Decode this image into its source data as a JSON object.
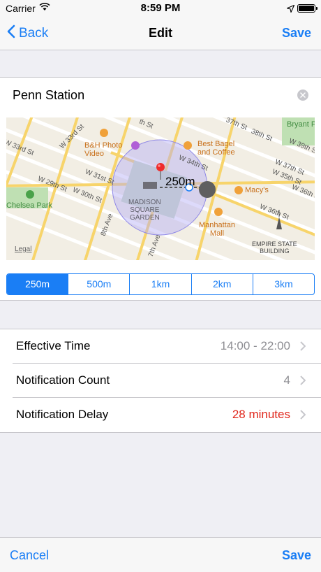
{
  "status": {
    "carrier": "Carrier",
    "time": "8:59 PM"
  },
  "nav": {
    "back_label": "Back",
    "title": "Edit",
    "save_label": "Save"
  },
  "location": {
    "name": "Penn Station"
  },
  "map": {
    "radius_label": "250m",
    "legal": "Legal",
    "streets": [
      "W 33rd St",
      "W 31st St",
      "W 30th St",
      "W 29th St",
      "W 34th St",
      "W 36th St",
      "8th Ave",
      "7th Ave",
      "37th St",
      "38th St",
      "W 39th St",
      "W 37th St",
      "W 35th St",
      "W 36th St",
      "W 33rd St",
      "th St"
    ],
    "pois": {
      "bh": "B&H Photo\nVideo",
      "bagel": "Best Bagel\nand Coffee",
      "macys": "Macy's",
      "manhattan_mall": "Manhattan\nMall",
      "chelsea_park": "Chelsea Park",
      "bryant": "Bryant P",
      "msg": "MADISON\nSQUARE\nGARDEN",
      "esb": "EMPIRE STATE\nBUILDING"
    }
  },
  "radius_options": {
    "selected": "250m",
    "items": [
      "250m",
      "500m",
      "1km",
      "2km",
      "3km"
    ]
  },
  "settings": [
    {
      "label": "Effective Time",
      "value": "14:00 - 22:00",
      "value_color": "#8e8e93"
    },
    {
      "label": "Notification Count",
      "value": "4",
      "value_color": "#8e8e93"
    },
    {
      "label": "Notification Delay",
      "value": "28 minutes",
      "value_color": "#e0261b"
    }
  ],
  "toolbar": {
    "cancel_label": "Cancel",
    "save_label": "Save"
  },
  "colors": {
    "accent": "#1a7ef5",
    "warning": "#e0261b"
  }
}
